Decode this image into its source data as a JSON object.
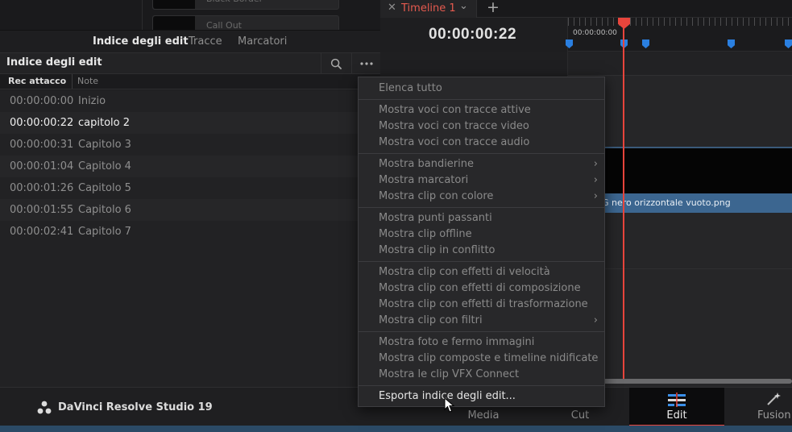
{
  "media_pool": {
    "clips": [
      {
        "name": "Black Border"
      },
      {
        "name": "Call Out"
      }
    ]
  },
  "edit_index_panel": {
    "tabs": [
      "Indice degli edit",
      "Tracce",
      "Marcatori"
    ],
    "title": "Indice degli edit",
    "columns": {
      "rec_in": "Rec attacco",
      "notes": "Note"
    },
    "rows": [
      {
        "timecode": "00:00:00:00",
        "note": "Inizio"
      },
      {
        "timecode": "00:00:00:22",
        "note": "capitolo 2"
      },
      {
        "timecode": "00:00:00:31",
        "note": "Capitolo 3"
      },
      {
        "timecode": "00:00:01:04",
        "note": "Capitolo 4"
      },
      {
        "timecode": "00:00:01:26",
        "note": "Capitolo 5"
      },
      {
        "timecode": "00:00:01:55",
        "note": "Capitolo 6"
      },
      {
        "timecode": "00:00:02:41",
        "note": "Capitolo 7"
      }
    ],
    "selected_row": 1
  },
  "timeline": {
    "tab_name": "Timeline 1",
    "timecode": "00:00:00:22",
    "ruler_start": "00:00:00:00",
    "clip_label": "G nero orizzontale vuoto.png",
    "playhead_color": "#e8453c",
    "marker_color": "#2a7fe0"
  },
  "context_menu": {
    "items": [
      {
        "label": "Elenca tutto",
        "submenu": false,
        "bright": false
      },
      {
        "label": "Mostra voci con tracce attive",
        "submenu": false,
        "bright": false
      },
      {
        "label": "Mostra voci con tracce video",
        "submenu": false,
        "bright": false
      },
      {
        "label": "Mostra voci con tracce audio",
        "submenu": false,
        "bright": false
      },
      {
        "label": "Mostra bandierine",
        "submenu": true,
        "bright": false
      },
      {
        "label": "Mostra marcatori",
        "submenu": true,
        "bright": false
      },
      {
        "label": "Mostra clip con colore",
        "submenu": true,
        "bright": false
      },
      {
        "label": "Mostra punti passanti",
        "submenu": false,
        "bright": false
      },
      {
        "label": "Mostra clip offline",
        "submenu": false,
        "bright": false
      },
      {
        "label": "Mostra clip in conflitto",
        "submenu": false,
        "bright": false
      },
      {
        "label": "Mostra clip con effetti di velocità",
        "submenu": false,
        "bright": false
      },
      {
        "label": "Mostra clip con effetti di composizione",
        "submenu": false,
        "bright": false
      },
      {
        "label": "Mostra clip con effetti di trasformazione",
        "submenu": false,
        "bright": false
      },
      {
        "label": "Mostra clip con filtri",
        "submenu": true,
        "bright": false
      },
      {
        "label": "Mostra foto e fermo immagini",
        "submenu": false,
        "bright": false
      },
      {
        "label": "Mostra clip composte e timeline nidificate",
        "submenu": false,
        "bright": false
      },
      {
        "label": "Mostra le clip VFX Connect",
        "submenu": false,
        "bright": false
      },
      {
        "label": "Esporta indice degli edit...",
        "submenu": false,
        "bright": true
      }
    ]
  },
  "bottom_bar": {
    "app_name": "DaVinci Resolve Studio 19",
    "pages": [
      "Media",
      "Cut",
      "Edit",
      "Fusion"
    ],
    "active_page": "Edit"
  }
}
